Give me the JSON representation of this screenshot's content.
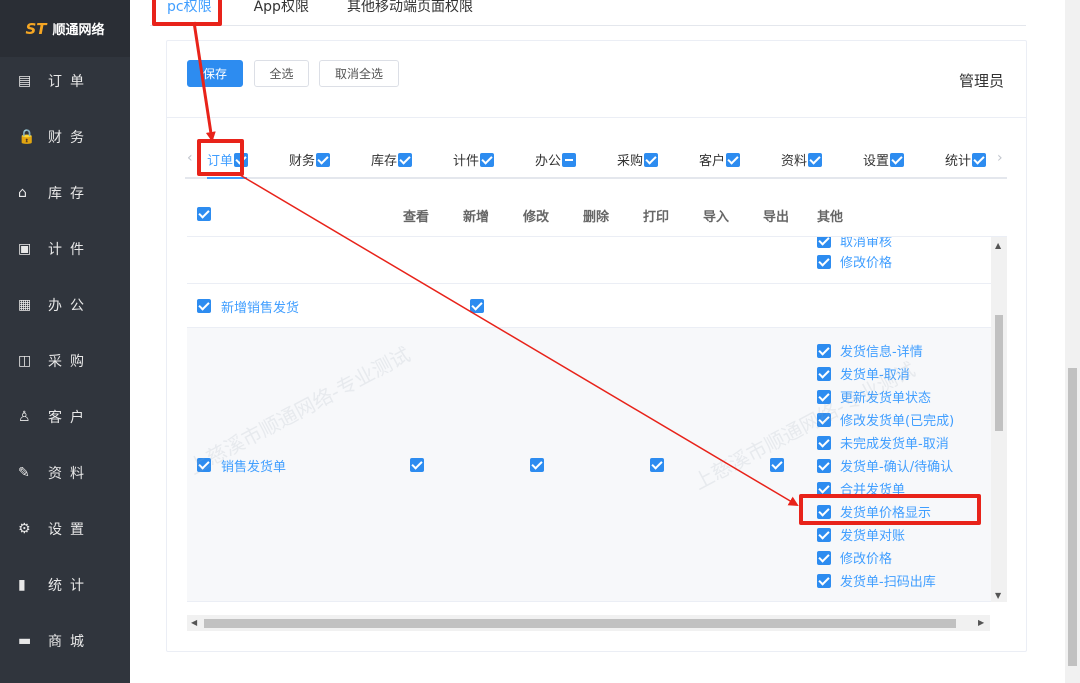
{
  "brand": {
    "logo": "ST",
    "name": "顺通网络"
  },
  "sidebar": {
    "items": [
      {
        "label": "订单",
        "icon": "order-icon"
      },
      {
        "label": "财务",
        "icon": "lock-icon"
      },
      {
        "label": "库存",
        "icon": "home-icon"
      },
      {
        "label": "计件",
        "icon": "clipboard-icon"
      },
      {
        "label": "办公",
        "icon": "calendar-icon"
      },
      {
        "label": "采购",
        "icon": "shopping-bag-icon"
      },
      {
        "label": "客户",
        "icon": "user-icon"
      },
      {
        "label": "资料",
        "icon": "pen-icon"
      },
      {
        "label": "设置",
        "icon": "gear-icon"
      },
      {
        "label": "统计",
        "icon": "bar-chart-icon"
      },
      {
        "label": "商城",
        "icon": "store-icon"
      }
    ]
  },
  "top_tabs": [
    "pc权限",
    "App权限",
    "其他移动端页面权限"
  ],
  "toolbar": {
    "save": "保存",
    "select_all": "全选",
    "deselect_all": "取消全选"
  },
  "role": "管理员",
  "module_tabs": [
    {
      "label": "订单",
      "state": "checked"
    },
    {
      "label": "财务",
      "state": "checked"
    },
    {
      "label": "库存",
      "state": "checked"
    },
    {
      "label": "计件",
      "state": "checked"
    },
    {
      "label": "办公",
      "state": "indeterminate"
    },
    {
      "label": "采购",
      "state": "checked"
    },
    {
      "label": "客户",
      "state": "checked"
    },
    {
      "label": "资料",
      "state": "checked"
    },
    {
      "label": "设置",
      "state": "checked"
    },
    {
      "label": "统计",
      "state": "checked"
    }
  ],
  "table": {
    "headers": [
      "查看",
      "新增",
      "修改",
      "删除",
      "打印",
      "导入",
      "导出",
      "其他"
    ],
    "rows": [
      {
        "label": "",
        "other": [
          "取消审核",
          "修改价格"
        ]
      },
      {
        "label": "新增销售发货",
        "other": []
      },
      {
        "label": "销售发货单",
        "other": [
          "发货信息-详情",
          "发货单-取消",
          "更新发货单状态",
          "修改发货单(已完成)",
          "未完成发货单-取消",
          "发货单-确认/待确认",
          "合并发货单",
          "发货单价格显示",
          "发货单对账",
          "修改价格",
          "发货单-扫码出库"
        ]
      }
    ]
  },
  "watermark": "上慈溪市顺通网络-专业测试",
  "colors": {
    "accent": "#2d8cf0",
    "sidebar_bg": "#30353d",
    "annotation": "#e8231a"
  }
}
